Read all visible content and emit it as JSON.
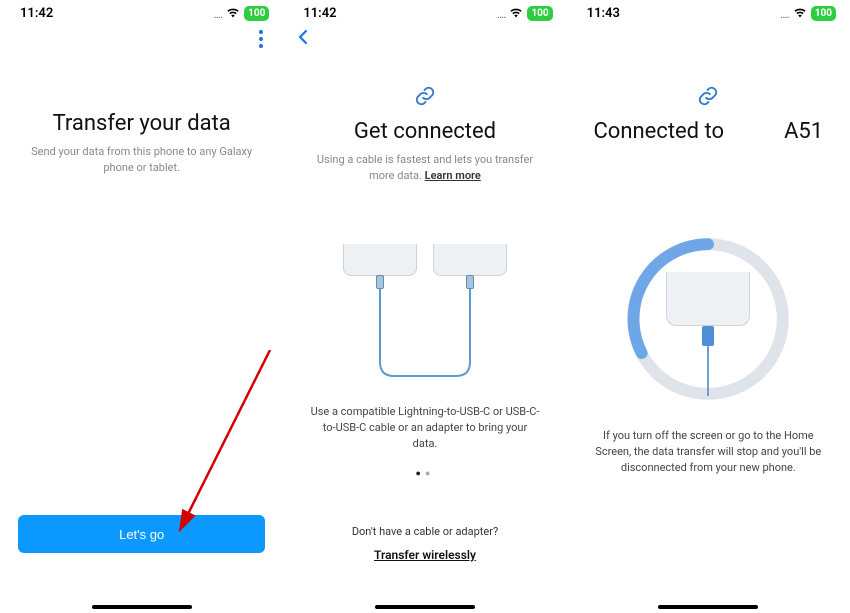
{
  "screens": [
    {
      "status": {
        "time": "11:42",
        "battery": "100"
      },
      "title": "Transfer your data",
      "subtitle": "Send your data from this phone to any Galaxy phone or tablet.",
      "primary_button": "Let's go"
    },
    {
      "status": {
        "time": "11:42",
        "battery": "100"
      },
      "title": "Get connected",
      "subtitle_pre": "Using a cable is fastest and lets you transfer more data. ",
      "subtitle_link": "Learn more",
      "caption": "Use a compatible Lightning-to-USB-C or USB-C-to-USB-C cable or an adapter to bring your data.",
      "bottom_question": "Don't have a cable or adapter?",
      "bottom_link": "Transfer wirelessly"
    },
    {
      "status": {
        "time": "11:43",
        "battery": "100"
      },
      "title_left": "Connected to",
      "title_right": "A51",
      "caption": "If you turn off the screen or go to the Home Screen, the data transfer will stop and you'll be disconnected from your new phone."
    }
  ]
}
